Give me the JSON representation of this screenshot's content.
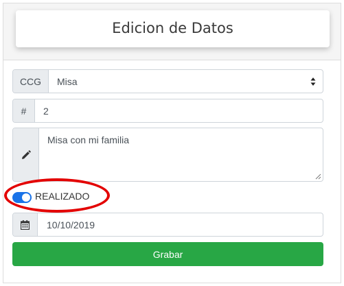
{
  "header": {
    "title": "Edicion de Datos"
  },
  "form": {
    "ccg": {
      "addon_label": "CCG",
      "selected": "Misa",
      "icon": "sort-icon"
    },
    "number": {
      "addon_label": "#",
      "value": "2"
    },
    "description": {
      "icon": "pencil-icon",
      "value": "Misa con mi familia"
    },
    "realizado": {
      "label": "REALIZADO",
      "checked": true
    },
    "date": {
      "icon": "calendar-icon",
      "value": "10/10/2019"
    },
    "save_label": "Grabar"
  },
  "colors": {
    "toggle_on": "#1a73e8",
    "save_button": "#28a745",
    "annotation_oval": "#e30000"
  }
}
